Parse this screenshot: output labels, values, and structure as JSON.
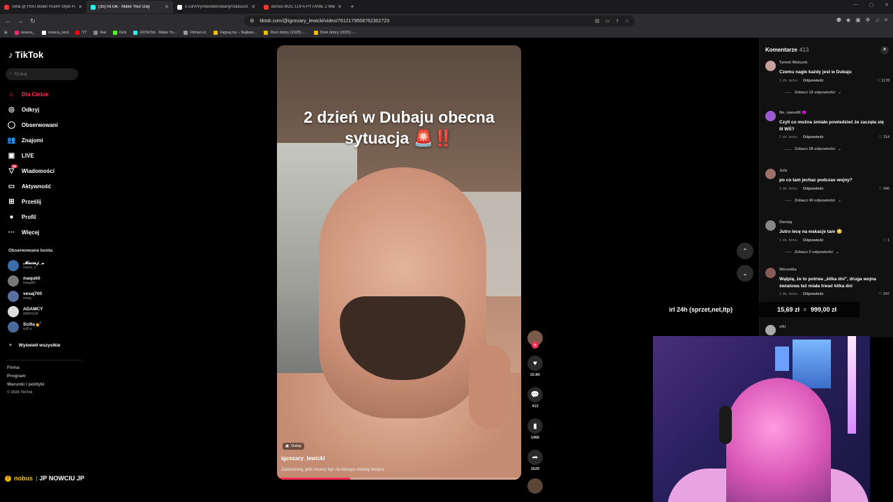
{
  "browser": {
    "tabs": [
      {
        "title": "Sefa @ HSU Boiler Room Style Party",
        "color": "#e53935",
        "active": false
      },
      {
        "title": "(35)TikTok - Make Your Day",
        "color": "#25f4ee",
        "active": true
      },
      {
        "title": "x.com/Vyrewolwerowany/status/2023",
        "color": "#ffffff",
        "active": false
      },
      {
        "title": "Bonus BGC LUFA PYTANIE 2 Mielno",
        "color": "#e53935",
        "active": false
      }
    ],
    "url": "tiktok.com/@igcezary_lewicki/video/7612179558762302723",
    "bookmarks": [
      {
        "label": "nowciu_",
        "color": "#e1306c"
      },
      {
        "label": "nowciu_kick",
        "color": "#ffffff"
      },
      {
        "label": "YT",
        "color": "#ff0000"
      },
      {
        "label": "Rat",
        "color": "#888888"
      },
      {
        "label": "Kick",
        "color": "#53fc18"
      },
      {
        "label": "(4)TikTok - Make Yo...",
        "color": "#25f4ee"
      },
      {
        "label": "Filman.cc",
        "color": "#999999"
      },
      {
        "label": "Zagraj.my – Najleps...",
        "color": "#f0c000"
      },
      {
        "label": "Dom dobry (2025) -...",
        "color": "#f0c000"
      },
      {
        "label": "Dom dobry (2025) -...",
        "color": "#f0c000"
      }
    ]
  },
  "tiktok": {
    "logo": "TikTok",
    "search_placeholder": "Szukaj",
    "menu": [
      {
        "label": "Dla Ciebie",
        "icon": "home-icon",
        "glyph": "⌂",
        "active": true
      },
      {
        "label": "Odkryj",
        "icon": "compass-icon",
        "glyph": "◎",
        "active": false
      },
      {
        "label": "Obserwowani",
        "icon": "following-icon",
        "glyph": "◯",
        "active": false
      },
      {
        "label": "Znajomi",
        "icon": "friends-icon",
        "glyph": "👥",
        "active": false
      },
      {
        "label": "LIVE",
        "icon": "live-icon",
        "glyph": "▣",
        "active": false
      },
      {
        "label": "Wiadomości",
        "icon": "messages-icon",
        "glyph": "▽",
        "active": false,
        "badge": "35"
      },
      {
        "label": "Aktywność",
        "icon": "activity-icon",
        "glyph": "▭",
        "active": false
      },
      {
        "label": "Prześlij",
        "icon": "upload-icon",
        "glyph": "⊞",
        "active": false
      },
      {
        "label": "Profil",
        "icon": "profile-icon",
        "glyph": "●",
        "active": false
      },
      {
        "label": "Więcej",
        "icon": "more-icon",
        "glyph": "···",
        "active": false
      }
    ],
    "followed_header": "Obserwowane konta",
    "followed": [
      {
        "name": "𝓜𝓪𝓬𝓲𝓮𝓳_𝔁",
        "handle": "maeci_x"
      },
      {
        "name": "maquk0",
        "handle": "maquk0"
      },
      {
        "name": "vesaj700",
        "handle": "vesaj"
      },
      {
        "name": "ADAMCY",
        "handle": "adamcyal"
      },
      {
        "name": "Scilla 💅",
        "handle": "scill.a"
      }
    ],
    "show_all": "Wyświetl wszystkie",
    "footer": [
      "Firma",
      "Program",
      "Warunki i polityki"
    ],
    "copyright": "© 2026 TikTok"
  },
  "video": {
    "overlay_line1": "2 dzień w Dubaju obecna",
    "overlay_line2": "sytuacja",
    "overlay_emoji": "🚨‼️",
    "location": "Dubaj",
    "author": "igcezary_lewicki",
    "description": "Zaobserwuj, jeśli chcesz być na bieżąco #dubaj #wojna",
    "progress": 0.3,
    "likes": "15.9K",
    "comments": "413",
    "saves": "1466",
    "shares": "1629"
  },
  "comments_panel": {
    "title": "Komentarze",
    "count": "413",
    "items": [
      {
        "user": "Tymek Walszok",
        "text": "Czemu nagle każdy jest w Dubaju",
        "time": "1 dn. temu",
        "reply": "Odpowiedz",
        "likes": "1178",
        "replies": "Zobacz 19 odpowiedzi"
      },
      {
        "user": "No_name66 😈",
        "text": "Czyli co można śmiało powiedzieć że zaczęła się III WŚ?",
        "time": "1 dn. temu",
        "reply": "Odpowiedz",
        "likes": "114",
        "replies": "Zobacz 28 odpowiedzi"
      },
      {
        "user": "Jula",
        "text": "po co tam jechac podczas wojny?",
        "time": "1 dn. temu",
        "reply": "Odpowiedz",
        "likes": "346",
        "replies": "Zobacz 49 odpowiedzi"
      },
      {
        "user": "Daviqq",
        "text": "Jutro lecę na wakacje tam 😳",
        "time": "1 dn. temu",
        "reply": "Odpowiedz",
        "likes": "1",
        "replies": "Zobacz 2 odpowiedzi"
      },
      {
        "user": "Weronika",
        "text": "Wątpię, że to potrwa „kilka dni\", druga wojna światowa też miała trwać kilka dni",
        "time": "1 dn. temu",
        "reply": "Odpowiedz",
        "likes": "247",
        "replies": ""
      },
      {
        "user": "viki",
        "text": "",
        "time": "",
        "reply": "",
        "likes": "",
        "replies": ""
      }
    ]
  },
  "goal": {
    "title": "irl 24h (sprzet,net,ltp)",
    "current": "15,69 zł",
    "separator": "z",
    "target": "999,00 zł"
  },
  "chat": {
    "user": "nobus",
    "message": ": JP NOWCIU JP"
  }
}
